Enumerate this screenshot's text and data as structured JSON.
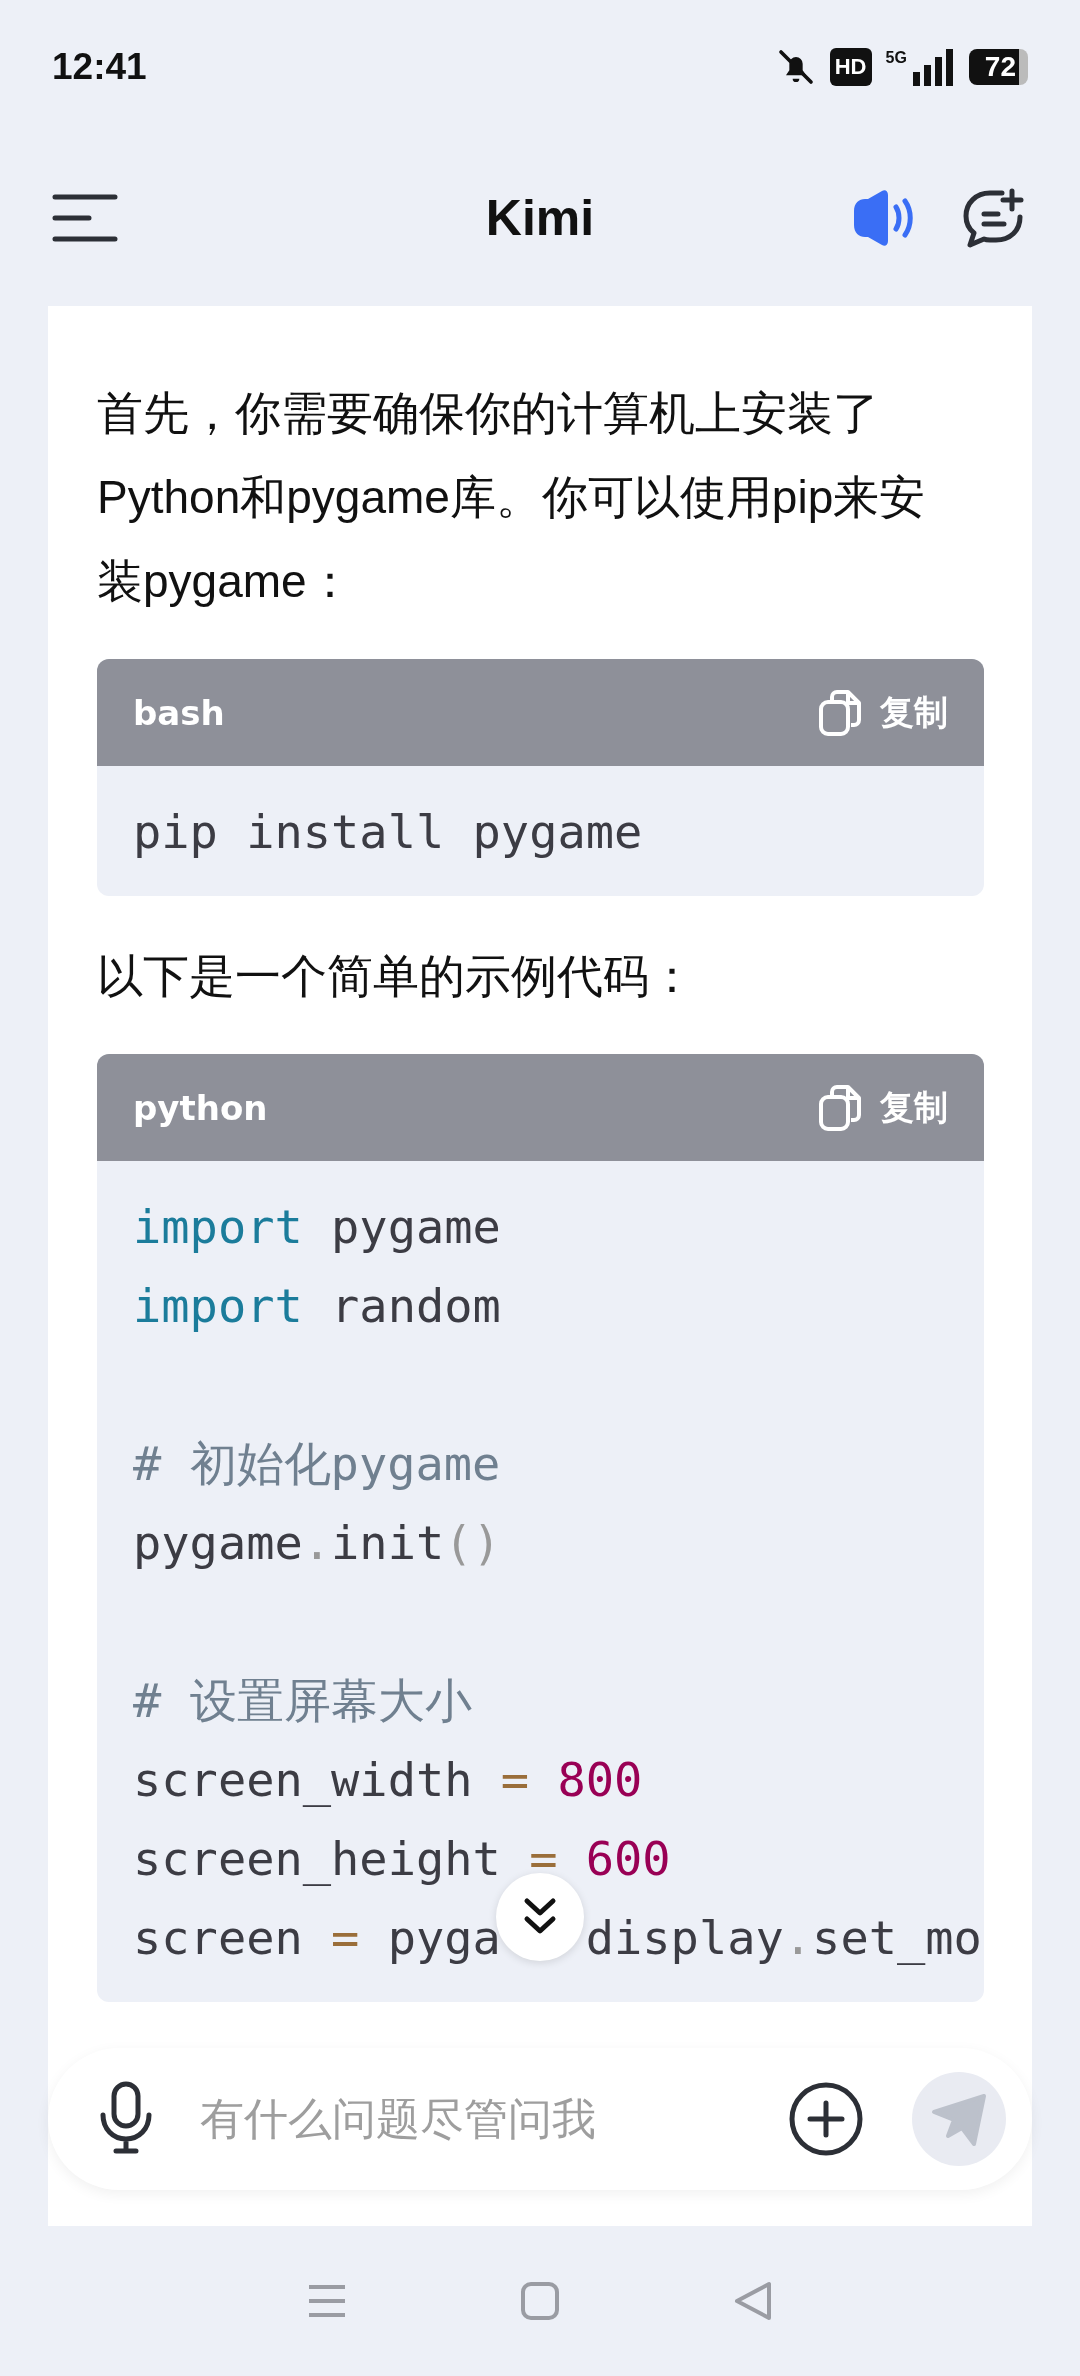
{
  "status_bar": {
    "time": "12:41",
    "hd": "HD",
    "network": "5G",
    "battery": "72"
  },
  "header": {
    "title": "Kimi"
  },
  "message": {
    "blocks": [
      {
        "kind": "paragraph",
        "text": "首先，你需要确保你的计算机上安装了Python和pygame库。你可以使用pip来安装pygame："
      },
      {
        "kind": "code",
        "language": "bash",
        "copy_label": "复制",
        "lines": [
          {
            "kind": "code",
            "tokens": [
              {
                "kind": "plain",
                "text": "pip install pygame"
              }
            ]
          }
        ]
      },
      {
        "kind": "paragraph",
        "text": "以下是一个简单的示例代码："
      },
      {
        "kind": "code",
        "language": "python",
        "copy_label": "复制",
        "lines": [
          {
            "kind": "code",
            "tokens": [
              {
                "kind": "keyword",
                "text": "import"
              },
              {
                "kind": "plain",
                "text": " pygame"
              }
            ]
          },
          {
            "kind": "code",
            "tokens": [
              {
                "kind": "keyword",
                "text": "import"
              },
              {
                "kind": "plain",
                "text": " random"
              }
            ]
          },
          {
            "kind": "blank"
          },
          {
            "kind": "code",
            "tokens": [
              {
                "kind": "comment",
                "text": "# 初始化pygame"
              }
            ]
          },
          {
            "kind": "code",
            "tokens": [
              {
                "kind": "plain",
                "text": "pygame"
              },
              {
                "kind": "punctuation",
                "text": "."
              },
              {
                "kind": "plain",
                "text": "init"
              },
              {
                "kind": "punctuation",
                "text": "()"
              }
            ]
          },
          {
            "kind": "blank"
          },
          {
            "kind": "code",
            "tokens": [
              {
                "kind": "comment",
                "text": "# 设置屏幕大小"
              }
            ]
          },
          {
            "kind": "code",
            "tokens": [
              {
                "kind": "plain",
                "text": "screen_width "
              },
              {
                "kind": "operator",
                "text": "="
              },
              {
                "kind": "number",
                "text": " 800"
              }
            ]
          },
          {
            "kind": "code",
            "tokens": [
              {
                "kind": "plain",
                "text": "screen_height "
              },
              {
                "kind": "operator",
                "text": "="
              },
              {
                "kind": "number",
                "text": " 600"
              }
            ]
          },
          {
            "kind": "code",
            "tokens": [
              {
                "kind": "plain",
                "text": "screen "
              },
              {
                "kind": "operator",
                "text": "="
              },
              {
                "kind": "plain",
                "text": " pyga"
              },
              {
                "kind": "covered"
              },
              {
                "kind": "plain",
                "text": "display"
              },
              {
                "kind": "punctuation",
                "text": "."
              },
              {
                "kind": "plain",
                "text": "set_mo"
              }
            ]
          }
        ]
      }
    ]
  },
  "input": {
    "placeholder": "有什么问题尽管问我"
  }
}
